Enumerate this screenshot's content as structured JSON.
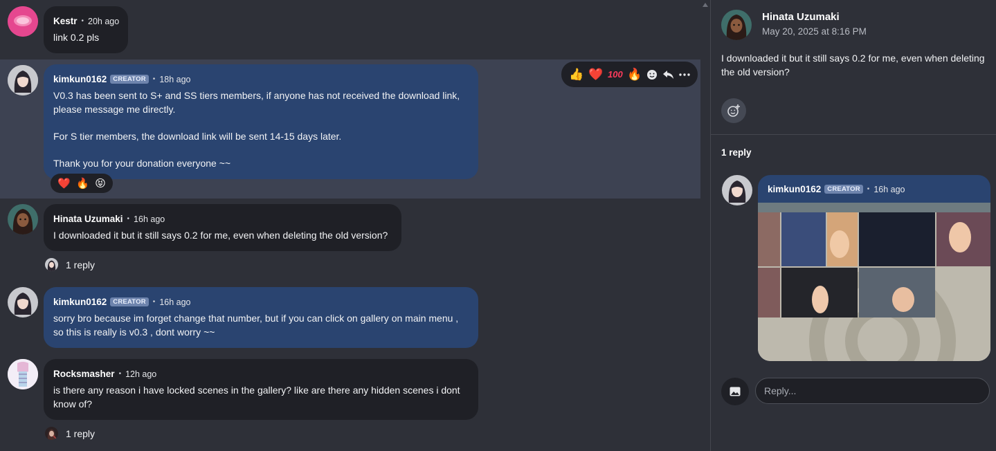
{
  "comments": [
    {
      "author": "Kestr",
      "time": "20h ago",
      "lines": [
        "link 0.2 pls"
      ]
    },
    {
      "author": "kimkun0162",
      "badge": "CREATOR",
      "time": "18h ago",
      "lines": [
        "V0.3 has been sent to S+ and SS tiers members, if anyone has not received the download link,",
        "please message me directly.",
        "",
        "For S tier members, the download link will be sent 14-15 days later.",
        "",
        "Thank you for your donation everyone ~~"
      ],
      "reactions": [
        "heart",
        "fire",
        "grin"
      ]
    },
    {
      "author": "Hinata Uzumaki",
      "time": "16h ago",
      "lines": [
        "I downloaded it but it still says 0.2 for me, even when deleting the old version?"
      ],
      "replies": "1 reply"
    },
    {
      "author": "kimkun0162",
      "badge": "CREATOR",
      "time": "16h ago",
      "lines": [
        "sorry bro because im forget change that number, but if you can click on gallery on main menu ,",
        "so this is really is v0.3 , dont worry ~~"
      ]
    },
    {
      "author": "Rocksmasher",
      "time": "12h ago",
      "lines": [
        "is there any reason i have locked scenes in the gallery? like are there any hidden scenes i dont",
        "know of?"
      ],
      "replies": "1 reply"
    }
  ],
  "toolbar": {
    "icons": [
      "thumbs-up",
      "heart",
      "hundred",
      "fire",
      "smiley",
      "reply",
      "more"
    ]
  },
  "thread": {
    "author": "Hinata Uzumaki",
    "date": "May 20, 2025 at 8:16 PM",
    "text": "I downloaded it but it still says 0.2 for me, even when deleting the old version?",
    "reply_count": "1 reply",
    "reply": {
      "author": "kimkun0162",
      "badge": "CREATOR",
      "time": "16h ago"
    },
    "reply_placeholder": "Reply..."
  },
  "colors": {
    "background": "#2e3038",
    "bubble_dark": "#1f2026",
    "bubble_creator": "#2a4470",
    "highlight": "#3d4252",
    "badge": "#6e84ad"
  }
}
